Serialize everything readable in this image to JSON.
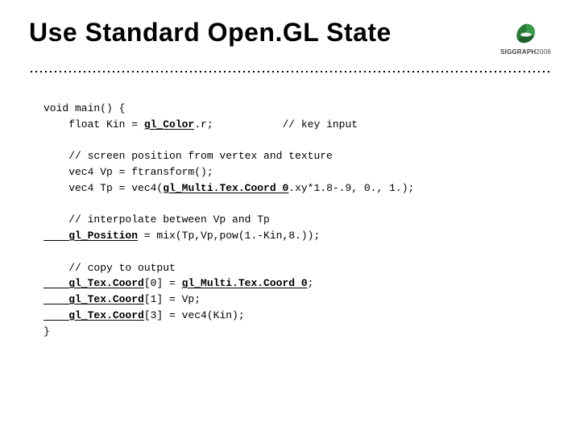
{
  "header": {
    "title": "Use Standard Open.GL State",
    "logo_text_bold": "SIGGRAPH",
    "logo_text_year": "2006"
  },
  "code": {
    "l1a": "void main() {",
    "l2a": "    float Kin = ",
    "l2h": "gl_Color",
    "l2b": ".r;           // key input",
    "bl1": "",
    "l3": "    // screen position from vertex and texture",
    "l4": "    vec4 Vp = ftransform();",
    "l5a": "    vec4 Tp = vec4(",
    "l5h": "gl_Multi.Tex.Coord 0",
    "l5b": ".xy*1.8-.9, 0., 1.);",
    "bl2": "",
    "l6": "    // interpolate between Vp and Tp",
    "l7h": "    gl_Position",
    "l7b": " = mix(Tp,Vp,pow(1.-Kin,8.));",
    "bl3": "",
    "l8": "    // copy to output",
    "l9h": "    gl_Tex.Coord",
    "l9m": "[0] = ",
    "l9h2": "gl_Multi.Tex.Coord 0",
    "l9b": ";",
    "l10h": "    gl_Tex.Coord",
    "l10b": "[1] = Vp;",
    "l11h": "    gl_Tex.Coord",
    "l11b": "[3] = vec4(Kin);",
    "l12": "}"
  }
}
